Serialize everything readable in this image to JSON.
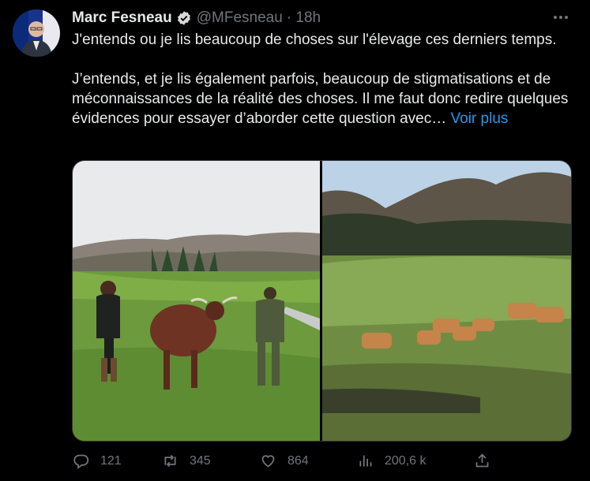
{
  "tweet": {
    "author_name": "Marc Fesneau",
    "author_handle": "@MFesneau",
    "time": "· 18h",
    "paragraph1": "J'entends ou je lis beaucoup de choses sur l'élevage ces derniers temps.",
    "paragraph2": "J’entends, et je lis également parfois, beaucoup de stigmatisations et de méconnaissances de la réalité des choses. Il me faut donc redire quelques évidences pour essayer d’aborder cette question avec…",
    "see_more": "Voir plus"
  },
  "actions": {
    "replies": "121",
    "retweets": "345",
    "likes": "864",
    "views": "200,6 k"
  },
  "icons": {
    "verified": "verified-badge-icon",
    "more": "more-options-icon",
    "reply": "reply-icon",
    "retweet": "retweet-icon",
    "like": "heart-icon",
    "views": "views-chart-icon",
    "share": "share-icon"
  },
  "colors": {
    "background": "#000000",
    "text": "#e7e9ea",
    "muted": "#71767b",
    "link": "#1d9bf0"
  }
}
